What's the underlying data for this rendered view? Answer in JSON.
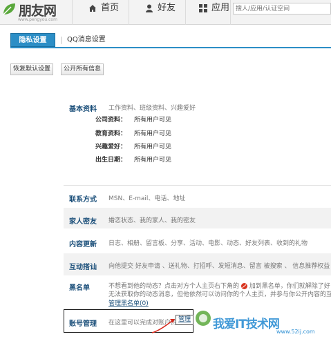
{
  "topbar": {
    "logo_text": "朋友网",
    "logo_url": "www.pengyou.com",
    "nav": [
      {
        "label": "首页",
        "icon": "home-icon"
      },
      {
        "label": "好友",
        "icon": "person-icon"
      },
      {
        "label": "应用",
        "icon": "grid-icon"
      }
    ],
    "search_placeholder": "搜人/应用/认证空间"
  },
  "tabs": {
    "active": "隐私设置",
    "other": "QQ消息设置"
  },
  "buttons": {
    "restore": "恢复默认设置",
    "public": "公开所有信息"
  },
  "sections": {
    "basic": {
      "title": "基本资料",
      "desc": "工作资料、班级资料、兴趣爱好",
      "fields": [
        {
          "label": "公司资料：",
          "value": "所有用户可见"
        },
        {
          "label": "教育资料：",
          "value": "所有用户可见"
        },
        {
          "label": "兴趣爱好：",
          "value": "所有用户可见"
        },
        {
          "label": "出生日期：",
          "value": "所有用户可见"
        }
      ]
    },
    "contact": {
      "title": "联系方式",
      "desc": "MSN、E-mail、电话、地址"
    },
    "family": {
      "title": "家人密友",
      "desc": "婚恋状态、我的家人、我的密友"
    },
    "updates": {
      "title": "内容更新",
      "desc": "日志、相册、留言板、分享、活动、电影、动态、好友列表、收到的礼物"
    },
    "interact": {
      "title": "互动搭讪",
      "desc": "向他提交 好友申请 、送礼物、打招呼、发短消息、留言 被搜索 、 信息推荐权益"
    },
    "blacklist": {
      "title": "黑名单",
      "line1": "不想看到他的动态？点击对方个人主页右下角的",
      "line1b": "加到黑名单，你们就解除了好",
      "line2": "无法获取你的动态消息，但他依然可以访问你的个人主页，并参与你公开内容的互",
      "link": "管理黑名单(0)"
    },
    "account": {
      "title": "账号管理",
      "desc": "在这里可以完成对账户的",
      "manage": "管理"
    }
  },
  "watermark": {
    "text": "我爱IT技术网",
    "url": "www.52ij.com"
  },
  "colors": {
    "accent": "#2c8ec6",
    "title_blue": "#1b4f7a",
    "watermark_blue": "#2d8fd3",
    "logo_green": "#5aa83c"
  }
}
